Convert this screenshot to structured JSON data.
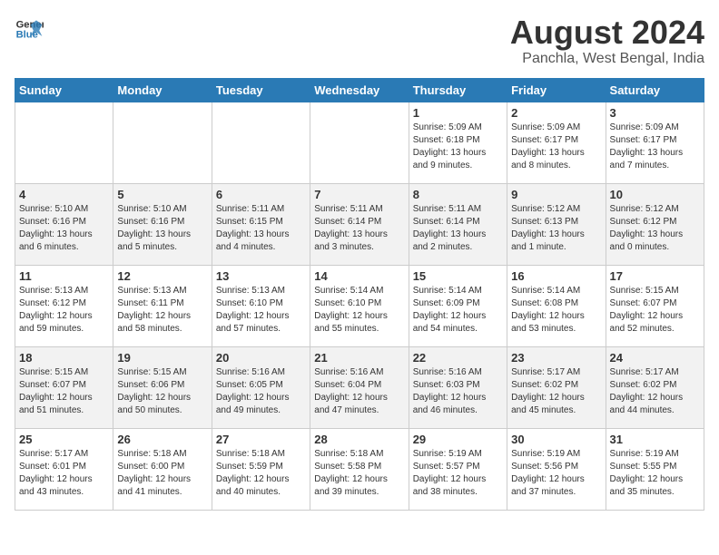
{
  "header": {
    "logo_line1": "General",
    "logo_line2": "Blue",
    "main_title": "August 2024",
    "subtitle": "Panchla, West Bengal, India"
  },
  "days_of_week": [
    "Sunday",
    "Monday",
    "Tuesday",
    "Wednesday",
    "Thursday",
    "Friday",
    "Saturday"
  ],
  "weeks": [
    [
      {
        "day": "",
        "content": ""
      },
      {
        "day": "",
        "content": ""
      },
      {
        "day": "",
        "content": ""
      },
      {
        "day": "",
        "content": ""
      },
      {
        "day": "1",
        "content": "Sunrise: 5:09 AM\nSunset: 6:18 PM\nDaylight: 13 hours\nand 9 minutes."
      },
      {
        "day": "2",
        "content": "Sunrise: 5:09 AM\nSunset: 6:17 PM\nDaylight: 13 hours\nand 8 minutes."
      },
      {
        "day": "3",
        "content": "Sunrise: 5:09 AM\nSunset: 6:17 PM\nDaylight: 13 hours\nand 7 minutes."
      }
    ],
    [
      {
        "day": "4",
        "content": "Sunrise: 5:10 AM\nSunset: 6:16 PM\nDaylight: 13 hours\nand 6 minutes."
      },
      {
        "day": "5",
        "content": "Sunrise: 5:10 AM\nSunset: 6:16 PM\nDaylight: 13 hours\nand 5 minutes."
      },
      {
        "day": "6",
        "content": "Sunrise: 5:11 AM\nSunset: 6:15 PM\nDaylight: 13 hours\nand 4 minutes."
      },
      {
        "day": "7",
        "content": "Sunrise: 5:11 AM\nSunset: 6:14 PM\nDaylight: 13 hours\nand 3 minutes."
      },
      {
        "day": "8",
        "content": "Sunrise: 5:11 AM\nSunset: 6:14 PM\nDaylight: 13 hours\nand 2 minutes."
      },
      {
        "day": "9",
        "content": "Sunrise: 5:12 AM\nSunset: 6:13 PM\nDaylight: 13 hours\nand 1 minute."
      },
      {
        "day": "10",
        "content": "Sunrise: 5:12 AM\nSunset: 6:12 PM\nDaylight: 13 hours\nand 0 minutes."
      }
    ],
    [
      {
        "day": "11",
        "content": "Sunrise: 5:13 AM\nSunset: 6:12 PM\nDaylight: 12 hours\nand 59 minutes."
      },
      {
        "day": "12",
        "content": "Sunrise: 5:13 AM\nSunset: 6:11 PM\nDaylight: 12 hours\nand 58 minutes."
      },
      {
        "day": "13",
        "content": "Sunrise: 5:13 AM\nSunset: 6:10 PM\nDaylight: 12 hours\nand 57 minutes."
      },
      {
        "day": "14",
        "content": "Sunrise: 5:14 AM\nSunset: 6:10 PM\nDaylight: 12 hours\nand 55 minutes."
      },
      {
        "day": "15",
        "content": "Sunrise: 5:14 AM\nSunset: 6:09 PM\nDaylight: 12 hours\nand 54 minutes."
      },
      {
        "day": "16",
        "content": "Sunrise: 5:14 AM\nSunset: 6:08 PM\nDaylight: 12 hours\nand 53 minutes."
      },
      {
        "day": "17",
        "content": "Sunrise: 5:15 AM\nSunset: 6:07 PM\nDaylight: 12 hours\nand 52 minutes."
      }
    ],
    [
      {
        "day": "18",
        "content": "Sunrise: 5:15 AM\nSunset: 6:07 PM\nDaylight: 12 hours\nand 51 minutes."
      },
      {
        "day": "19",
        "content": "Sunrise: 5:15 AM\nSunset: 6:06 PM\nDaylight: 12 hours\nand 50 minutes."
      },
      {
        "day": "20",
        "content": "Sunrise: 5:16 AM\nSunset: 6:05 PM\nDaylight: 12 hours\nand 49 minutes."
      },
      {
        "day": "21",
        "content": "Sunrise: 5:16 AM\nSunset: 6:04 PM\nDaylight: 12 hours\nand 47 minutes."
      },
      {
        "day": "22",
        "content": "Sunrise: 5:16 AM\nSunset: 6:03 PM\nDaylight: 12 hours\nand 46 minutes."
      },
      {
        "day": "23",
        "content": "Sunrise: 5:17 AM\nSunset: 6:02 PM\nDaylight: 12 hours\nand 45 minutes."
      },
      {
        "day": "24",
        "content": "Sunrise: 5:17 AM\nSunset: 6:02 PM\nDaylight: 12 hours\nand 44 minutes."
      }
    ],
    [
      {
        "day": "25",
        "content": "Sunrise: 5:17 AM\nSunset: 6:01 PM\nDaylight: 12 hours\nand 43 minutes."
      },
      {
        "day": "26",
        "content": "Sunrise: 5:18 AM\nSunset: 6:00 PM\nDaylight: 12 hours\nand 41 minutes."
      },
      {
        "day": "27",
        "content": "Sunrise: 5:18 AM\nSunset: 5:59 PM\nDaylight: 12 hours\nand 40 minutes."
      },
      {
        "day": "28",
        "content": "Sunrise: 5:18 AM\nSunset: 5:58 PM\nDaylight: 12 hours\nand 39 minutes."
      },
      {
        "day": "29",
        "content": "Sunrise: 5:19 AM\nSunset: 5:57 PM\nDaylight: 12 hours\nand 38 minutes."
      },
      {
        "day": "30",
        "content": "Sunrise: 5:19 AM\nSunset: 5:56 PM\nDaylight: 12 hours\nand 37 minutes."
      },
      {
        "day": "31",
        "content": "Sunrise: 5:19 AM\nSunset: 5:55 PM\nDaylight: 12 hours\nand 35 minutes."
      }
    ]
  ]
}
